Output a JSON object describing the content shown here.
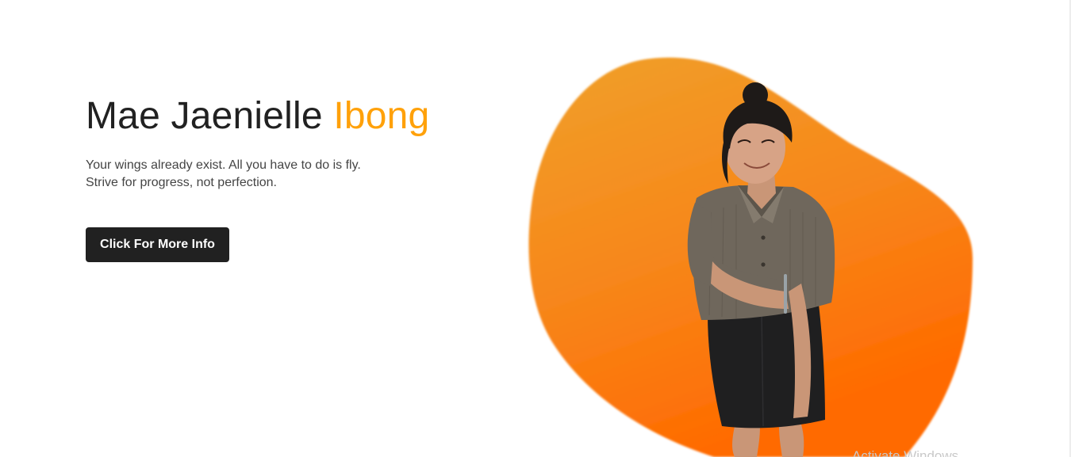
{
  "hero": {
    "name_first": "Mae Jaenielle",
    "name_last": "Ibong",
    "tagline_line1": "Your wings already exist. All you have to do is fly.",
    "tagline_line2": "Strive for progress, not perfection.",
    "cta_label": "Click For More Info"
  },
  "watermark": {
    "text": "Activate Windows"
  },
  "colors": {
    "accent": "#ffa10a",
    "dark": "#212121",
    "blob_top": "#f0a02a",
    "blob_bottom": "#ff6a00"
  }
}
